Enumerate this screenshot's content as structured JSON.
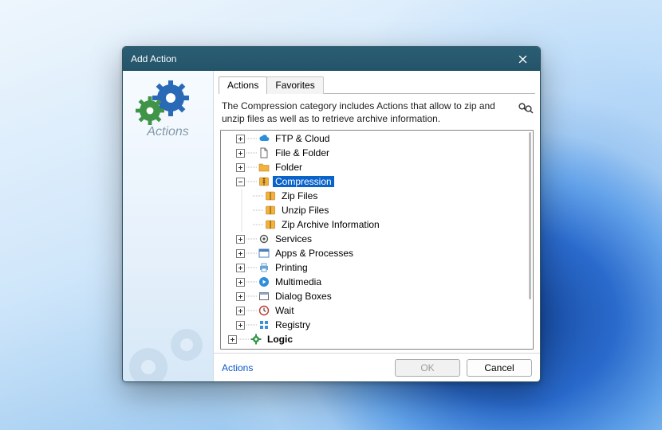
{
  "dialog": {
    "title": "Add Action",
    "close_aria": "Close"
  },
  "sidebar": {
    "title": "Actions"
  },
  "tabs": {
    "actions": "Actions",
    "favorites": "Favorites"
  },
  "description": "The Compression category includes Actions that allow to zip and unzip files as well as to retrieve archive information.",
  "tree": {
    "ftp_cloud": "FTP & Cloud",
    "file_folder": "File & Folder",
    "folder": "Folder",
    "compression": "Compression",
    "zip_files": "Zip Files",
    "unzip_files": "Unzip Files",
    "zip_archive_info": "Zip Archive Information",
    "services": "Services",
    "apps_processes": "Apps & Processes",
    "printing": "Printing",
    "multimedia": "Multimedia",
    "dialog_boxes": "Dialog Boxes",
    "wait": "Wait",
    "registry": "Registry",
    "logic": "Logic"
  },
  "footer": {
    "link": "Actions",
    "ok": "OK",
    "cancel": "Cancel"
  }
}
